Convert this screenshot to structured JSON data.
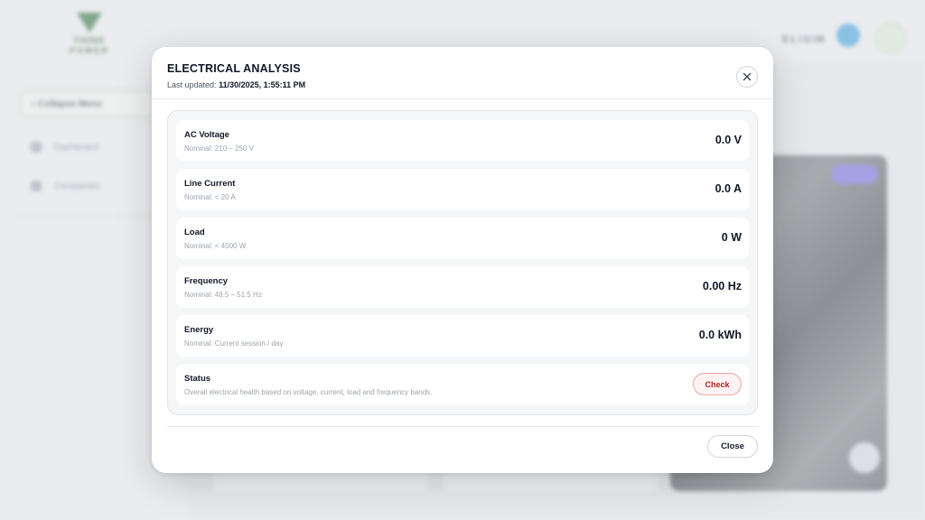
{
  "background": {
    "logo": {
      "line1": "THINK",
      "line2": "POWER"
    },
    "sidebar": {
      "collapse_label": "Collapse Menu",
      "items": [
        {
          "label": "Dashboard",
          "icon": "dashboard-icon"
        },
        {
          "label": "Companies",
          "icon": "building-icon"
        }
      ]
    },
    "brand": {
      "name": "ELISIM",
      "icon": "gear-icon"
    }
  },
  "modal": {
    "title": "ELECTRICAL ANALYSIS",
    "updated_label": "Last updated:",
    "updated_value": "11/30/2025, 1:55:11 PM",
    "close_icon": "close-icon",
    "metrics": [
      {
        "name": "AC Voltage",
        "nominal": "Nominal: 210 – 250 V",
        "value": "0.0 V"
      },
      {
        "name": "Line Current",
        "nominal": "Nominal: < 20 A",
        "value": "0.0 A"
      },
      {
        "name": "Load",
        "nominal": "Nominal: < 4000 W",
        "value": "0 W"
      },
      {
        "name": "Frequency",
        "nominal": "Nominal: 48.5 – 51.5 Hz",
        "value": "0.00 Hz"
      },
      {
        "name": "Energy",
        "nominal": "Nominal: Current session / day",
        "value": "0.0 kWh"
      }
    ],
    "status": {
      "name": "Status",
      "description": "Overall electrical health based on voltage, current, load and frequency bands.",
      "button_label": "Check",
      "button_color": "#b91c1c"
    },
    "footer_close_label": "Close"
  }
}
